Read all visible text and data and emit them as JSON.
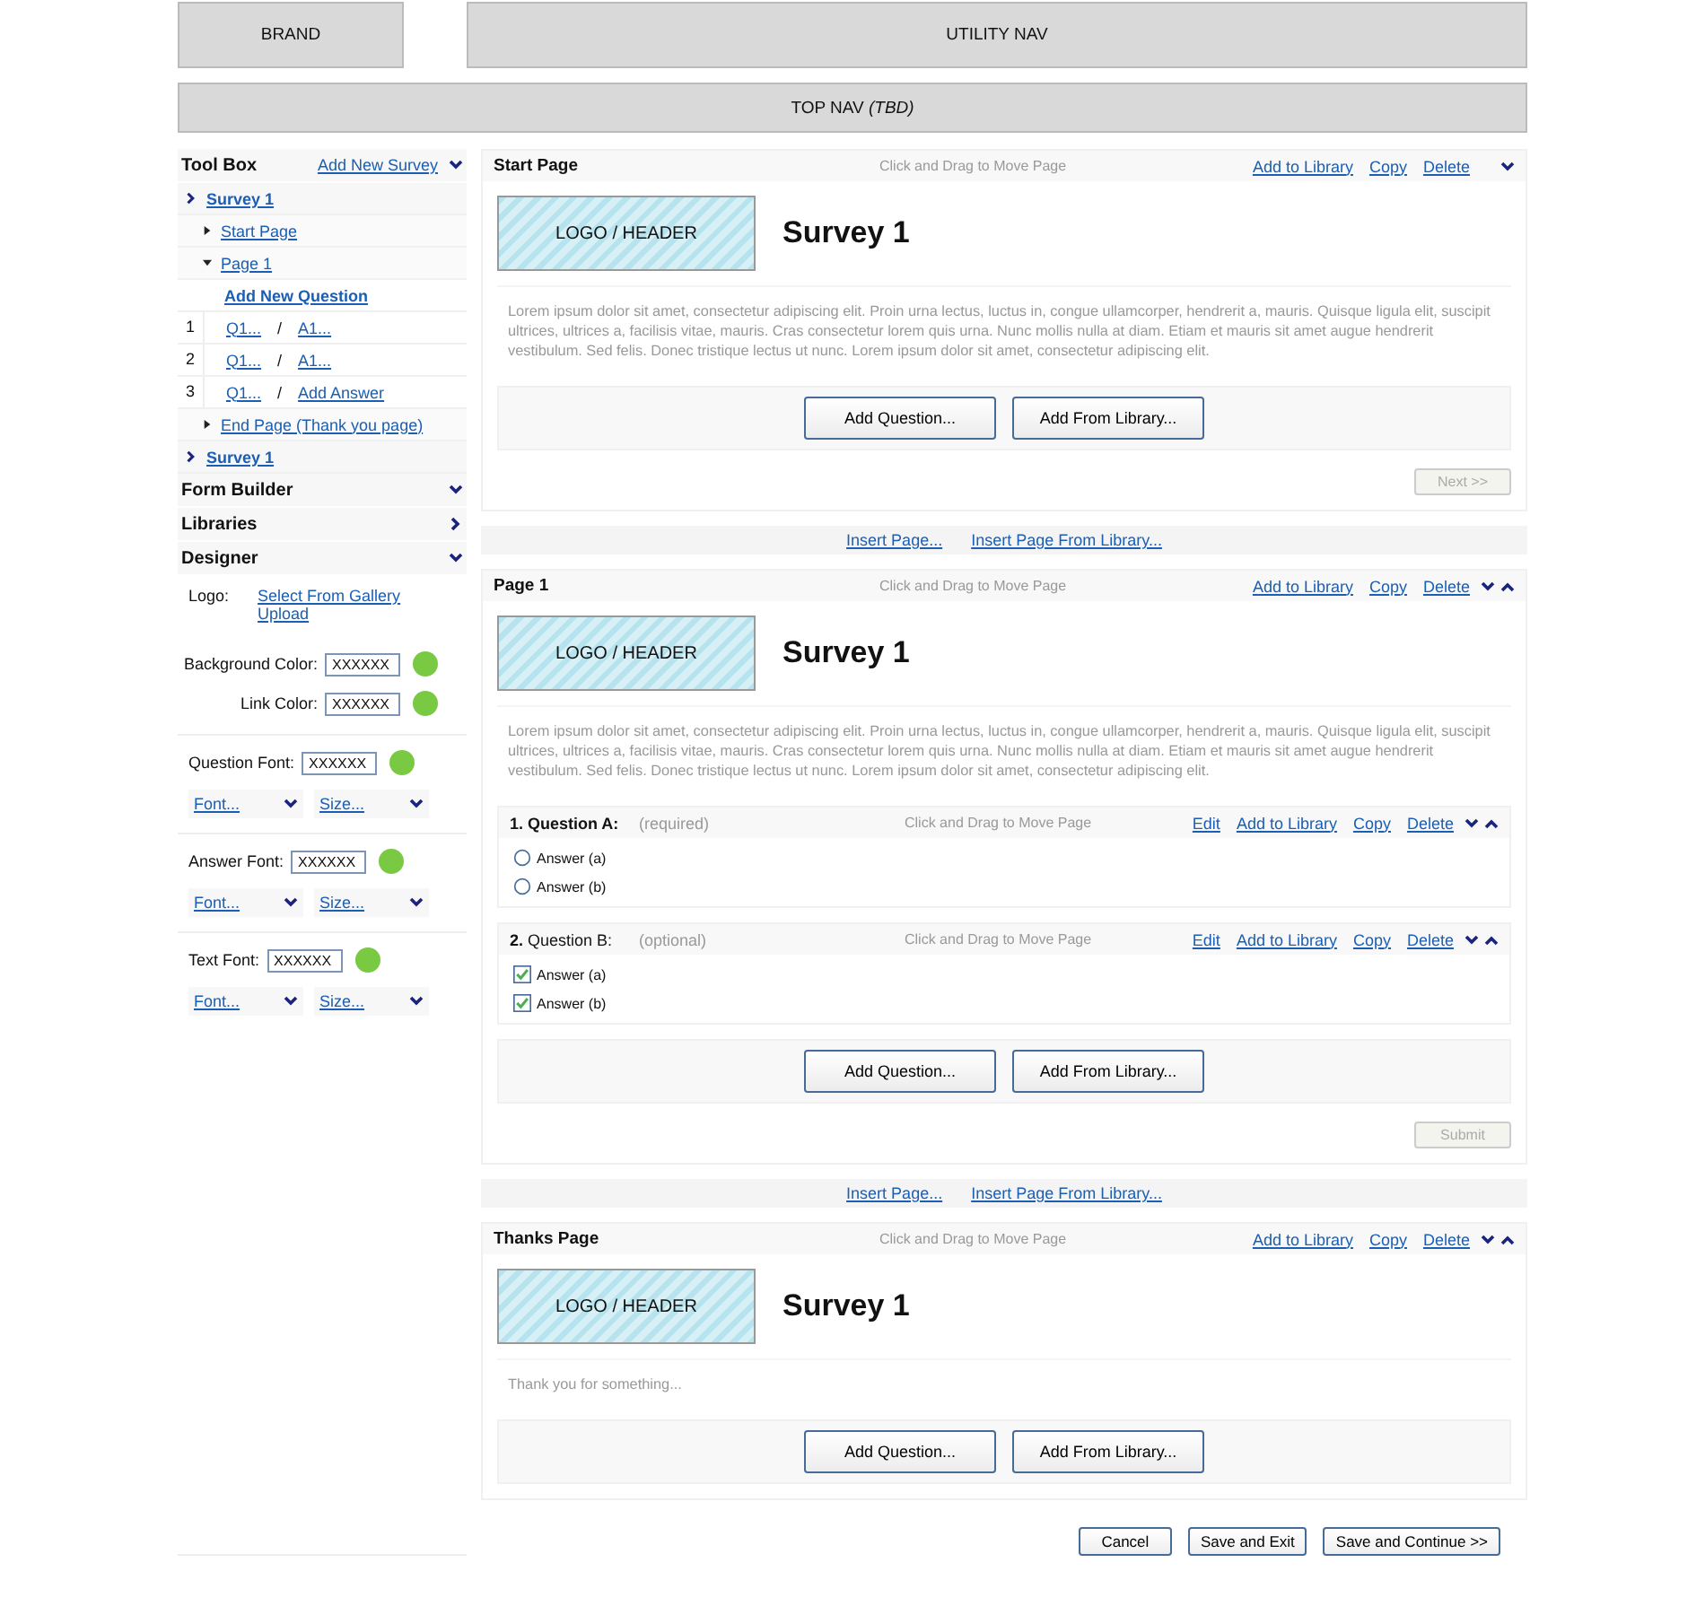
{
  "header": {
    "brand": "BRAND",
    "utility_nav": "UTILITY NAV",
    "top_nav": "TOP NAV *(TBD)*"
  },
  "toolbox": {
    "title": "Tool Box",
    "add_link": "Add New Survey",
    "expanded": true,
    "surveys": [
      {
        "label": "Survey 1",
        "children": [
          {
            "label": "Start Page",
            "expanded": false
          },
          {
            "label": "Page 1",
            "expanded": true,
            "add_link": "Add New Question",
            "questions": [
              {
                "number": "1",
                "question": "Q1...",
                "separator": "/",
                "answer": "A1..."
              },
              {
                "number": "2",
                "question": "Q1...",
                "separator": "/",
                "answer": "A1..."
              },
              {
                "number": "3",
                "question": "Q1...",
                "separator": "/",
                "answer": "Add Answer"
              }
            ]
          },
          {
            "label": "End Page (Thank you page)",
            "expanded": false
          }
        ]
      },
      {
        "label": "Survey 1"
      }
    ]
  },
  "sections": [
    {
      "title": "Form Builder",
      "expanded": true
    },
    {
      "title": "Libraries",
      "expanded": false
    },
    {
      "title": "Designer",
      "expanded": true
    }
  ],
  "designer": {
    "logo_label": "Logo:",
    "logo_links": [
      "Select From Gallery",
      "Upload"
    ],
    "colors": [
      {
        "label": "Background Color:",
        "value": "XXXXXX",
        "color": "#7ac943"
      },
      {
        "label": "Link Color:",
        "value": "XXXXXX",
        "color": "#7ac943"
      }
    ],
    "fonts": [
      {
        "label": "Question Font:",
        "value": "XXXXXX",
        "color": "#7ac943",
        "font": "Font...",
        "size": "Size..."
      },
      {
        "label": "Answer Font:",
        "value": "XXXXXX",
        "color": "#7ac943",
        "font": "Font...",
        "size": "Size..."
      },
      {
        "label": "Text Font:",
        "value": "XXXXXX",
        "color": "#7ac943",
        "font": "Font...",
        "size": "Size..."
      }
    ]
  },
  "main": [
    {
      "kind": "page",
      "title": "Start Page",
      "hint": "Click and Drag to Move Page",
      "actions": [
        "Add to Library",
        "Copy",
        "Delete"
      ],
      "move_up": false,
      "logo": "LOGO / HEADER",
      "survey_title": "Survey 1",
      "body": "Lorem ipsum dolor sit amet, consectetur adipiscing elit. Proin urna lectus, luctus in, congue ullamcorper, hendrerit a, mauris. Quisque ligula elit, suscipit ultrices, ultrices a, facilisis vitae, mauris. Cras consectetur lorem quis urna. Nunc mollis nulla at diam. Etiam et mauris sit amet augue hendrerit vestibulum. Sed felis. Donec tristique lectus ut nunc. Lorem ipsum dolor sit amet, consectetur adipiscing elit.",
      "buttons": [
        "Add Question...",
        "Add From Library..."
      ],
      "nav_button": {
        "label": "Next >>",
        "disabled": true
      }
    },
    {
      "kind": "insert",
      "links": [
        "Insert Page...",
        "Insert Page From Library..."
      ]
    },
    {
      "kind": "page",
      "title": "Page 1",
      "hint": "Click and Drag to Move Page",
      "actions": [
        "Add to Library",
        "Copy",
        "Delete"
      ],
      "move_up": true,
      "logo": "LOGO / HEADER",
      "survey_title": "Survey 1",
      "body": "Lorem ipsum dolor sit amet, consectetur adipiscing elit. Proin urna lectus, luctus in, congue ullamcorper, hendrerit a, mauris. Quisque ligula elit, suscipit ultrices, ultrices a, facilisis vitae, mauris. Cras consectetur lorem quis urna. Nunc mollis nulla at diam. Etiam et mauris sit amet augue hendrerit vestibulum. Sed felis. Donec tristique lectus ut nunc. Lorem ipsum dolor sit amet, consectetur adipiscing elit.",
      "questions": [
        {
          "title": "1. Question A:",
          "title_bold": true,
          "note": "(required)",
          "hint": "Click and Drag to Move Page",
          "actions": [
            "Edit",
            "Add to Library",
            "Copy",
            "Delete"
          ],
          "move_up": true,
          "answers": [
            {
              "kind": "radio",
              "label": "Answer (a)",
              "checked": false
            },
            {
              "kind": "radio",
              "label": "Answer (b)",
              "checked": false
            }
          ]
        },
        {
          "title": "**2.** Question B:",
          "title_bold": false,
          "note": "(optional)",
          "hint": "Click and Drag to Move Page",
          "actions": [
            "Edit",
            "Add to Library",
            "Copy",
            "Delete"
          ],
          "move_up": true,
          "answers": [
            {
              "kind": "checkbox",
              "label": "Answer (a)",
              "checked": true
            },
            {
              "kind": "checkbox",
              "label": "Answer (b)",
              "checked": true
            }
          ]
        }
      ],
      "buttons": [
        "Add Question...",
        "Add From Library..."
      ],
      "nav_button": {
        "label": "Submit",
        "disabled": true
      }
    },
    {
      "kind": "insert",
      "links": [
        "Insert Page...",
        "Insert Page From Library..."
      ]
    },
    {
      "kind": "page",
      "title": "Thanks Page",
      "hint": "Click and Drag to Move Page",
      "actions": [
        "Add to Library",
        "Copy",
        "Delete"
      ],
      "move_up": true,
      "logo": "LOGO / HEADER",
      "survey_title": "Survey 1",
      "body": "Thank you for something...",
      "buttons": [
        "Add Question...",
        "Add From Library..."
      ]
    }
  ],
  "footer_buttons": [
    "Cancel",
    "Save and Exit",
    "Save and Continue >>"
  ]
}
